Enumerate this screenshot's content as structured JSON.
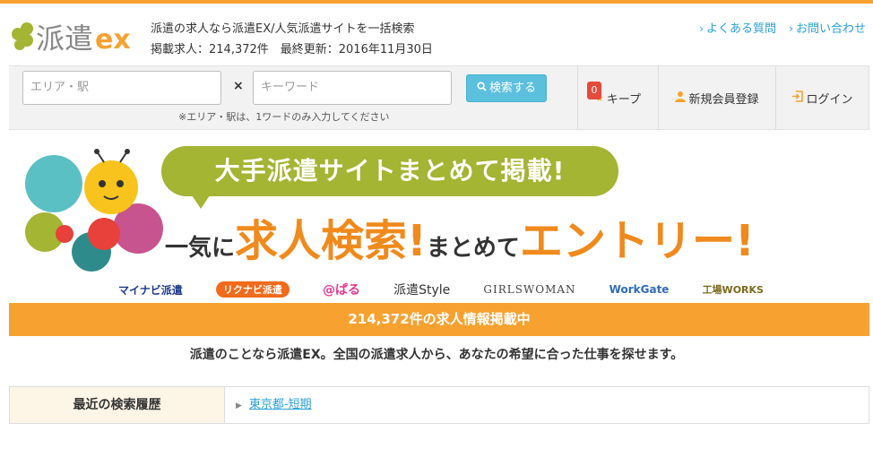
{
  "brand": {
    "logo_text": "派遣",
    "logo_suffix": "ex",
    "tagline": "派遣の求人なら派遣EX/人気派遣サイトを一括検索",
    "stats": "掲載求人：214,372件　最終更新：2016年11月30日"
  },
  "top_links": [
    {
      "label": "よくある質問"
    },
    {
      "label": "お問い合わせ"
    }
  ],
  "search": {
    "area_placeholder": "エリア・駅",
    "keyword_placeholder": "キーワード",
    "times": "×",
    "button_label": "検索する",
    "hint": "※エリア・駅は、1ワードのみ入力してください"
  },
  "nav": {
    "keep_count": "0",
    "keep_label": "キープ",
    "register_label": "新規会員登録",
    "login_label": "ログイン"
  },
  "banner": {
    "headline": "大手派遣サイトまとめて掲載!",
    "line_part1": "一気に",
    "line_part2": "求人検索!",
    "line_part3": "まとめて",
    "line_part4": "エントリー!",
    "partners": [
      "マイナビ派遣",
      "リクナビ派遣",
      "@ぱる",
      "派遣Style",
      "GIRLSWOMAN",
      "WorkGate",
      "工場WORKS"
    ]
  },
  "count_bar": "214,372件の求人情報掲載中",
  "description": "派遣のことなら派遣EX。全国の派遣求人から、あなたの希望に合った仕事を探せます。",
  "history": {
    "label": "最近の検索履歴",
    "items": [
      {
        "label": "東京都-短期"
      }
    ]
  },
  "colors": {
    "accent_orange": "#f7a230",
    "link_blue": "#2a9fd6",
    "search_button": "#5bc0de",
    "bubble_green": "#a4b433"
  }
}
